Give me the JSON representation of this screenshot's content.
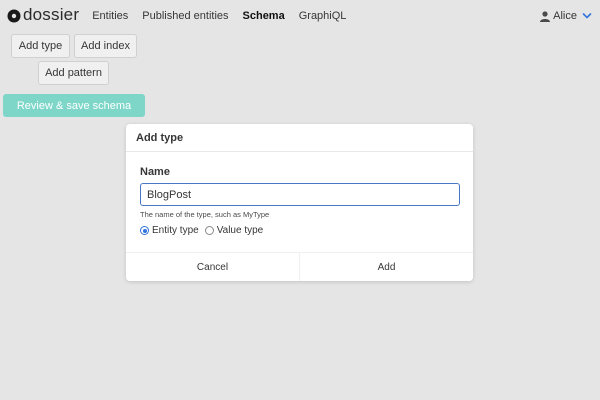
{
  "nav": {
    "brand": "dossier",
    "links": [
      "Entities",
      "Published entities",
      "Schema",
      "GraphiQL"
    ],
    "active": "Schema",
    "user": "Alice"
  },
  "toolbar": {
    "add_type": "Add type",
    "add_index": "Add index",
    "add_pattern": "Add pattern",
    "review_save": "Review & save schema"
  },
  "modal": {
    "title": "Add type",
    "field_label": "Name",
    "input_value": "BlogPost",
    "help_text": "The name of the type, such as MyType",
    "radio_options": [
      "Entity type",
      "Value type"
    ],
    "selected_radio": "Entity type",
    "cancel_label": "Cancel",
    "add_label": "Add"
  },
  "colors": {
    "primary": "#7dd6c8",
    "focus": "#4a78c4",
    "radio_selected": "#3273dc",
    "background": "#e5e5e5"
  }
}
